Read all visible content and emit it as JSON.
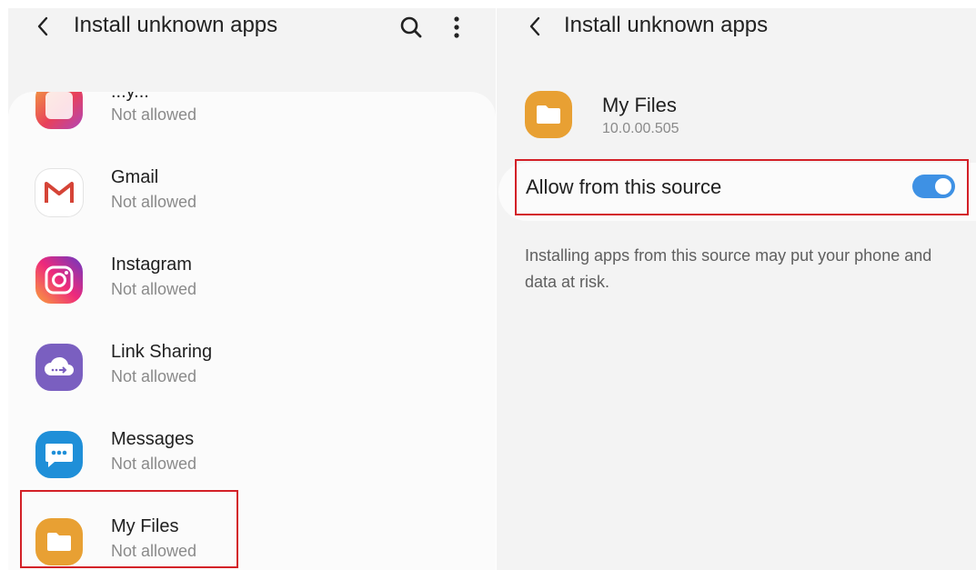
{
  "left_screen": {
    "title": "Install unknown apps",
    "apps": [
      {
        "name": "...y...",
        "status": "Not allowed",
        "icon": "gallery-app-icon"
      },
      {
        "name": "Gmail",
        "status": "Not allowed",
        "icon": "gmail-icon"
      },
      {
        "name": "Instagram",
        "status": "Not allowed",
        "icon": "instagram-icon"
      },
      {
        "name": "Link Sharing",
        "status": "Not allowed",
        "icon": "link-sharing-icon"
      },
      {
        "name": "Messages",
        "status": "Not allowed",
        "icon": "messages-icon"
      },
      {
        "name": "My Files",
        "status": "Not allowed",
        "icon": "my-files-icon"
      }
    ]
  },
  "right_screen": {
    "title": "Install unknown apps",
    "app_name": "My Files",
    "app_version": "10.0.00.505",
    "toggle_label": "Allow from this source",
    "toggle_on": true,
    "warning": "Installing apps from this source may put your phone and data at risk."
  },
  "colors": {
    "background": "#f3f3f3",
    "card": "#fbfbfb",
    "accent_toggle": "#3e91e4",
    "highlight": "#d32027",
    "my_files_icon": "#e8a033"
  }
}
